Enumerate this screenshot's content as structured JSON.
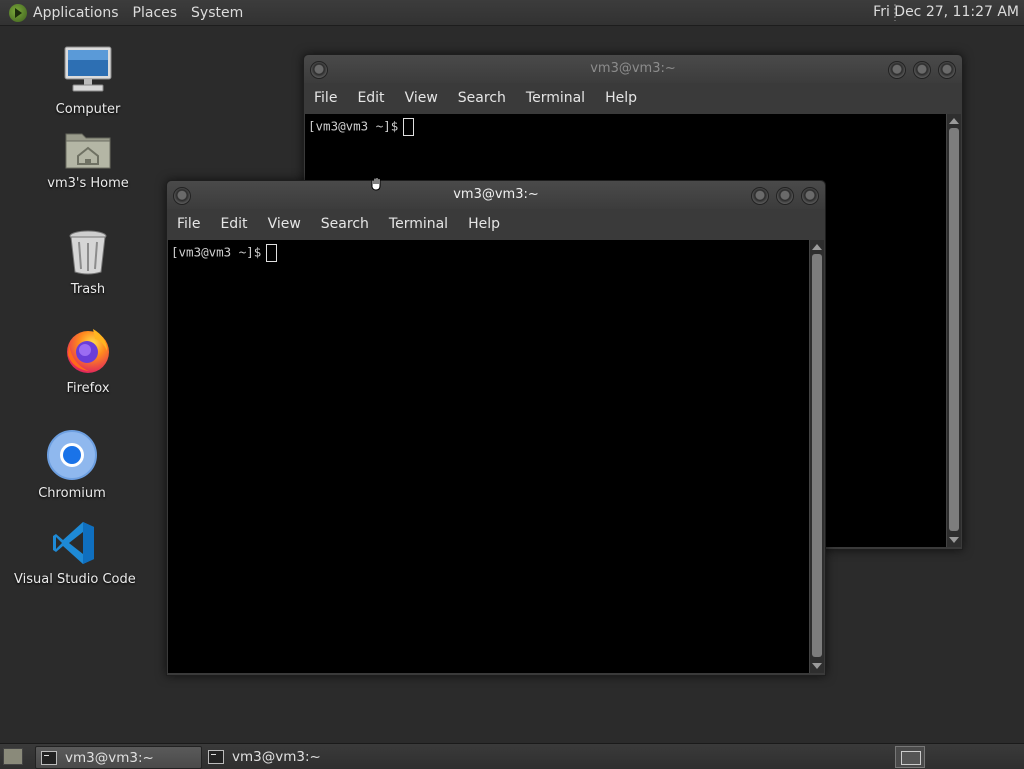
{
  "top_panel": {
    "menus": [
      "Applications",
      "Places",
      "System"
    ],
    "clock": "Fri Dec 27, 11:27 AM"
  },
  "desktop": {
    "icons": [
      {
        "label": "Computer",
        "icon": "computer-icon"
      },
      {
        "label": "vm3's Home",
        "icon": "home-folder-icon"
      },
      {
        "label": "Trash",
        "icon": "trash-icon"
      },
      {
        "label": "Firefox",
        "icon": "firefox-icon"
      },
      {
        "label": "Chromium",
        "icon": "chromium-icon"
      },
      {
        "label": "Visual Studio Code",
        "icon": "vscode-icon"
      }
    ]
  },
  "windows": {
    "back": {
      "title": "vm3@vm3:~",
      "menu": [
        "File",
        "Edit",
        "View",
        "Search",
        "Terminal",
        "Help"
      ],
      "prompt": "[vm3@vm3 ~]$"
    },
    "front": {
      "title": "vm3@vm3:~",
      "menu": [
        "File",
        "Edit",
        "View",
        "Search",
        "Terminal",
        "Help"
      ],
      "prompt": "[vm3@vm3 ~]$"
    }
  },
  "taskbar": {
    "tasks": [
      {
        "label": "vm3@vm3:~",
        "active": true
      },
      {
        "label": "vm3@vm3:~",
        "active": false
      }
    ]
  },
  "colors": {
    "desktop_bg": "#2b2b2b",
    "terminal_bg": "#000000",
    "panel_bg": "#363636"
  }
}
